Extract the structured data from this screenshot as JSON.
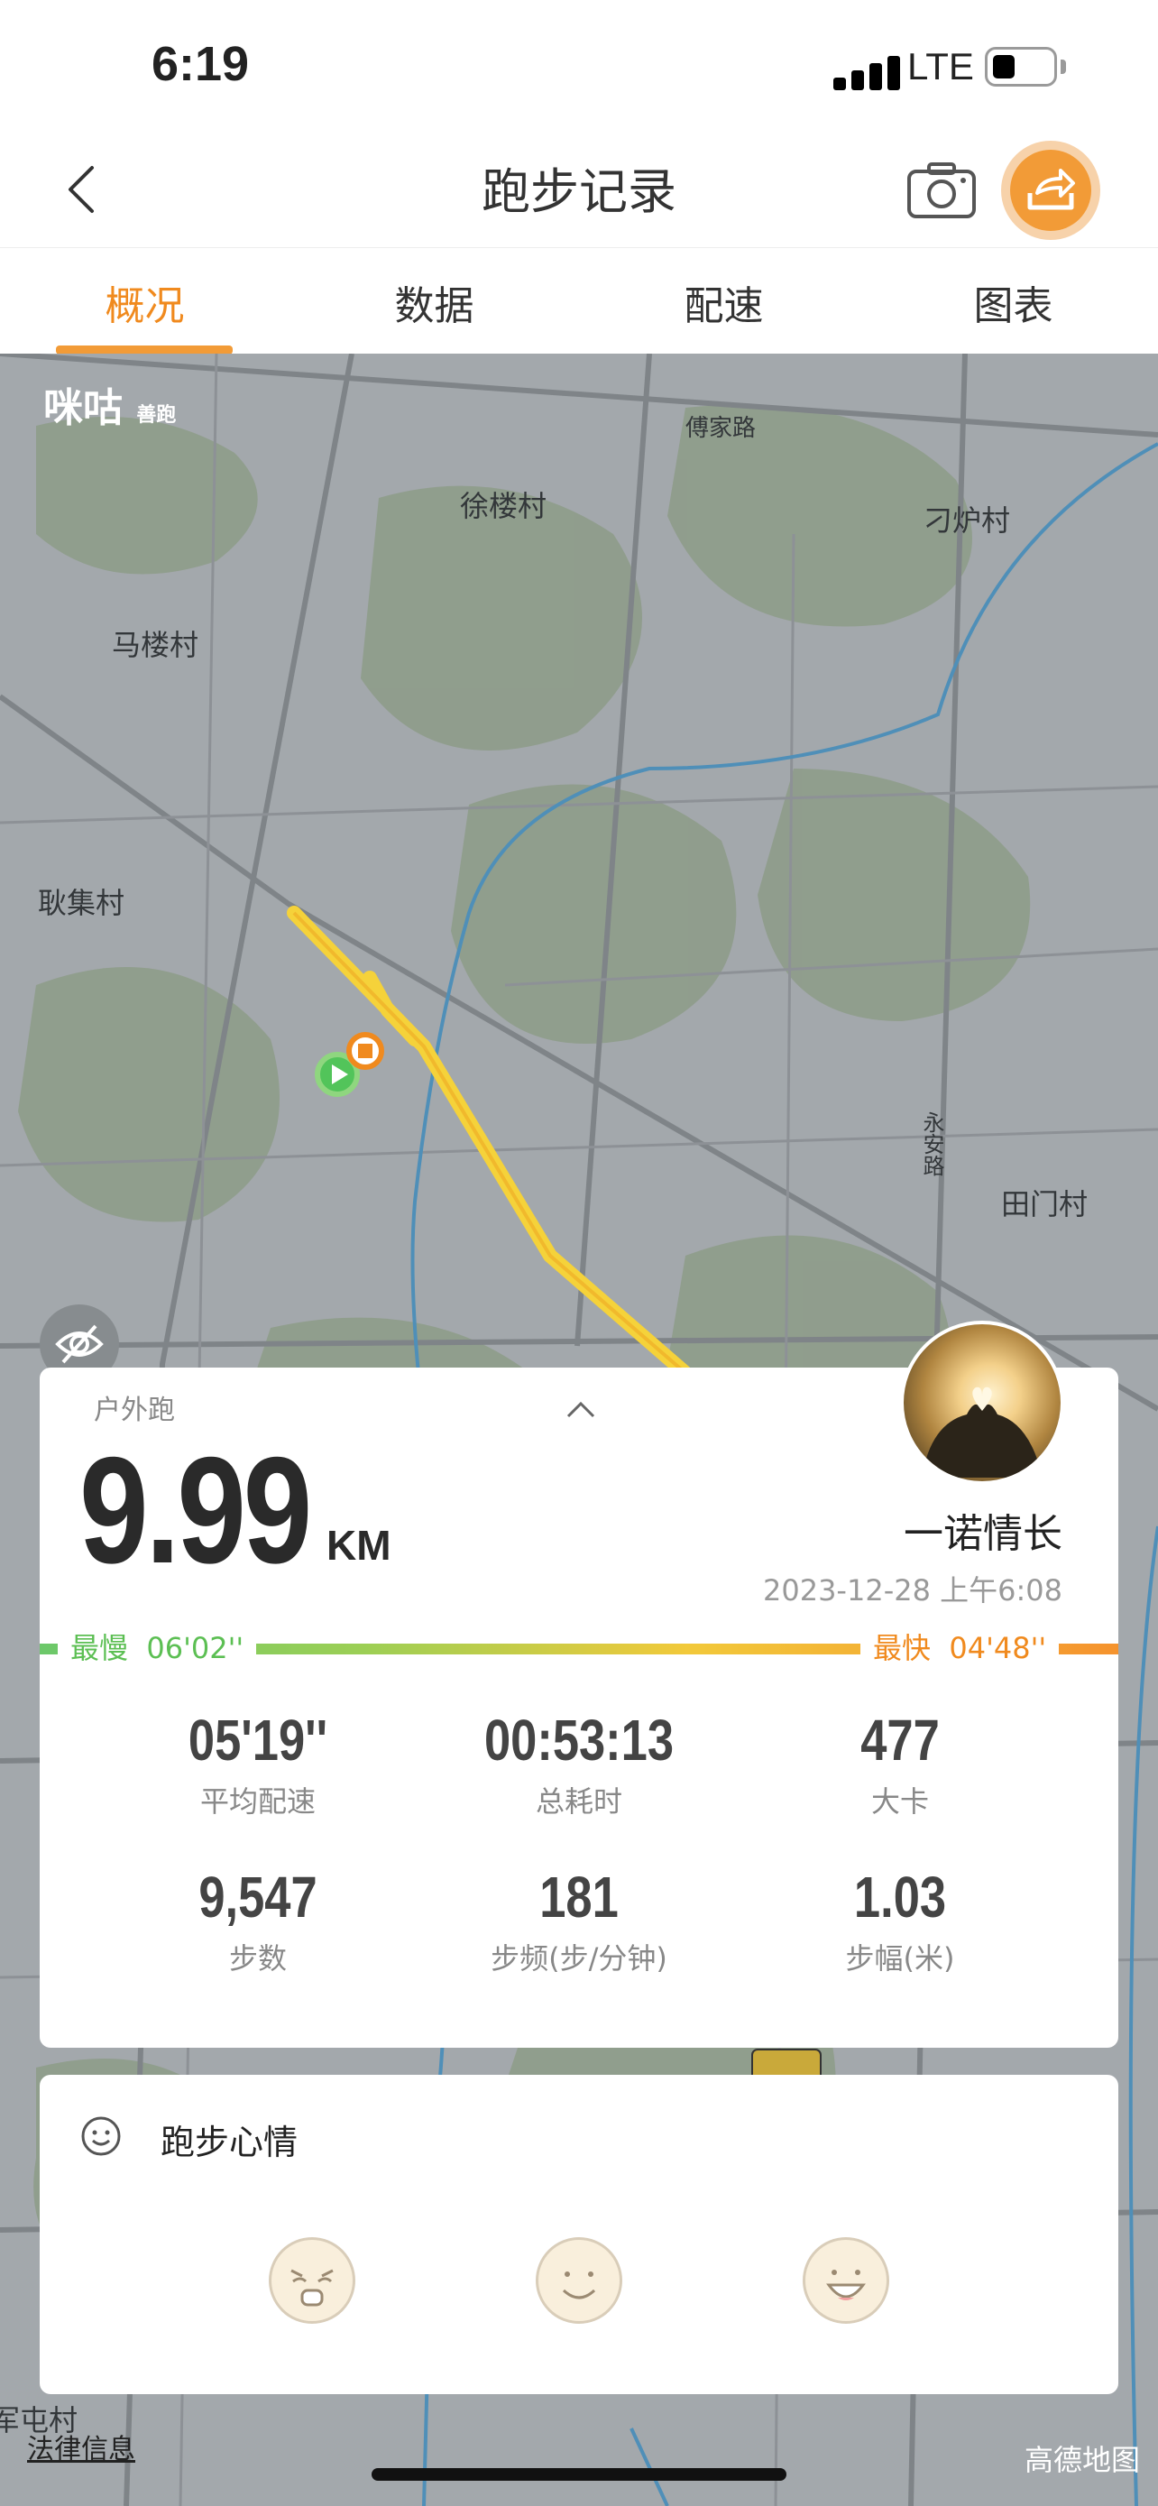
{
  "status_bar": {
    "time": "6:19",
    "network": "LTE"
  },
  "nav": {
    "title": "跑步记录"
  },
  "tabs": [
    {
      "label": "概况",
      "active": true
    },
    {
      "label": "数据",
      "active": false
    },
    {
      "label": "配速",
      "active": false
    },
    {
      "label": "图表",
      "active": false
    }
  ],
  "map": {
    "logo": "咪咕",
    "logo_sub": "善跑",
    "labels": {
      "road1": "傅家路",
      "village1": "徐楼村",
      "village2": "刁炉村",
      "village3": "马楼村",
      "village4": "耿集村",
      "road2": "永安路",
      "village5": "田门村",
      "village6": "军屯村"
    },
    "legal": "法律信息",
    "provider": "高德地图"
  },
  "summary": {
    "run_type": "户外跑",
    "distance": "9.99",
    "unit": "KM",
    "username": "一诺情长",
    "datetime": "2023-12-28 上午6:08",
    "slowest_label": "最慢",
    "slowest_value": "06'02''",
    "fastest_label": "最快",
    "fastest_value": "04'48''",
    "stats": [
      {
        "value": "05'19''",
        "label": "平均配速"
      },
      {
        "value": "00:53:13",
        "label": "总耗时"
      },
      {
        "value": "477",
        "label": "大卡"
      },
      {
        "value": "9,547",
        "label": "步数"
      },
      {
        "value": "181",
        "label": "步频(步/分钟)"
      },
      {
        "value": "1.03",
        "label": "步幅(米)"
      }
    ]
  },
  "mood": {
    "title": "跑步心情"
  },
  "colors": {
    "accent": "#f29b37",
    "route": "#f5d23a",
    "slow": "#5cbf53",
    "fast": "#f08a1e"
  }
}
